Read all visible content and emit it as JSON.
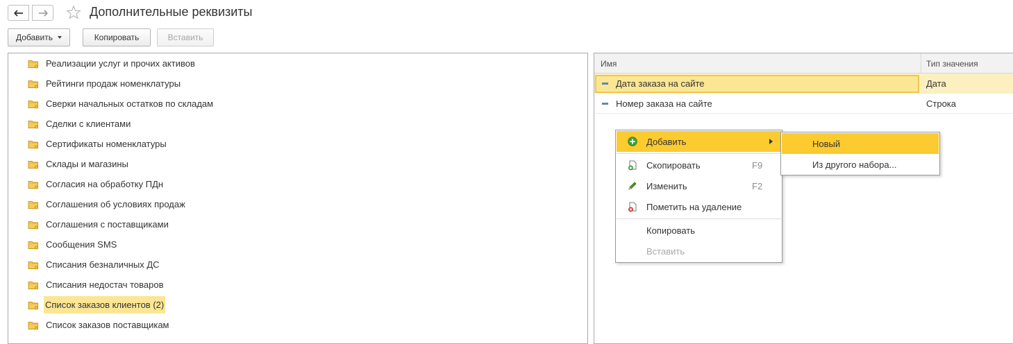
{
  "window": {
    "title": "Дополнительные реквизиты",
    "back_icon": "arrow-left-icon",
    "forward_icon": "arrow-right-icon",
    "favorite_icon": "star-icon"
  },
  "toolbar": {
    "add_label": "Добавить",
    "copy_label": "Копировать",
    "paste_label": "Вставить"
  },
  "tree": {
    "items": [
      {
        "label": "Реализации услуг и прочих активов"
      },
      {
        "label": "Рейтинги продаж номенклатуры"
      },
      {
        "label": "Сверки начальных остатков по складам"
      },
      {
        "label": "Сделки с клиентами"
      },
      {
        "label": "Сертификаты номенклатуры"
      },
      {
        "label": "Склады и магазины"
      },
      {
        "label": "Согласия на обработку ПДн"
      },
      {
        "label": "Соглашения об условиях продаж"
      },
      {
        "label": "Соглашения с поставщиками"
      },
      {
        "label": "Сообщения SMS"
      },
      {
        "label": "Списания безналичных ДС"
      },
      {
        "label": "Списания недостач товаров"
      },
      {
        "label": "Список заказов клиентов (2)",
        "selected": true
      },
      {
        "label": "Список заказов поставщикам"
      }
    ]
  },
  "grid": {
    "columns": [
      "Имя",
      "Тип значения"
    ],
    "rows": [
      {
        "name": "Дата заказа на сайте",
        "type": "Дата",
        "selected": true
      },
      {
        "name": "Номер заказа на сайте",
        "type": "Строка"
      }
    ]
  },
  "context_menu": {
    "items": [
      {
        "label": "Добавить",
        "icon": "add-circle-icon",
        "highlighted": true,
        "submenu": true
      },
      {
        "label": "Скопировать",
        "icon": "copy-icon",
        "shortcut": "F9"
      },
      {
        "label": "Изменить",
        "icon": "pencil-icon",
        "shortcut": "F2"
      },
      {
        "label": "Пометить на удаление",
        "icon": "delete-mark-icon"
      },
      {
        "label": "Копировать"
      },
      {
        "label": "Вставить",
        "disabled": true
      }
    ]
  },
  "submenu": {
    "items": [
      {
        "label": "Новый",
        "highlighted": true
      },
      {
        "label": "Из другого набора..."
      }
    ]
  },
  "colors": {
    "menu_highlight": "#fbcb2f",
    "row_selection": "#fbe694",
    "folder": "#f5cc5c"
  }
}
